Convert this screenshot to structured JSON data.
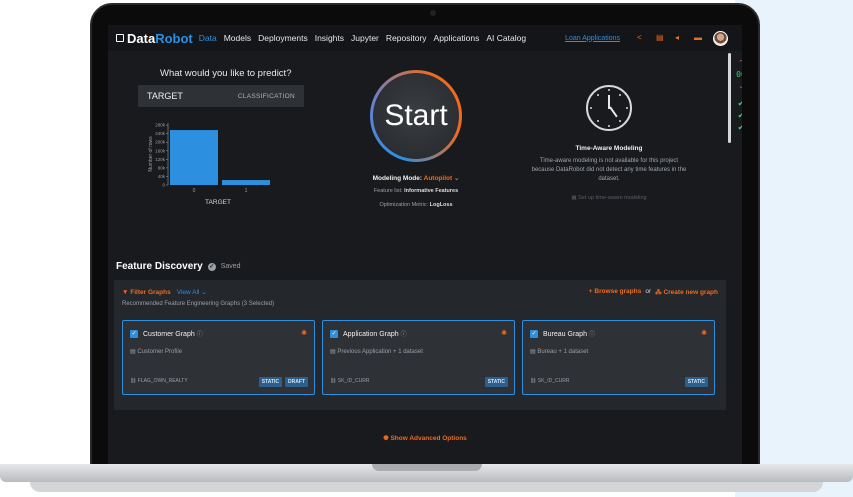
{
  "nav": {
    "logo_a": "Data",
    "logo_b": "Robot",
    "items": [
      "Data",
      "Models",
      "Deployments",
      "Insights",
      "Jupyter",
      "Repository",
      "Applications",
      "AI Catalog"
    ],
    "project_link": "Loan Applications",
    "icons": [
      "share-icon",
      "document-icon",
      "megaphone-icon",
      "folder-icon"
    ]
  },
  "rail": {
    "count": "00"
  },
  "predict": {
    "title": "What would you like to predict?",
    "target": "TARGET",
    "type": "CLASSIFICATION"
  },
  "chart_data": {
    "type": "bar",
    "categories": [
      "0",
      "1"
    ],
    "values": [
      257000,
      23000
    ],
    "xlabel": "TARGET",
    "ylabel": "Number of rows",
    "yticks": [
      "0",
      "40k",
      "80k",
      "120k",
      "160k",
      "200k",
      "240k",
      "280k"
    ],
    "ylim": [
      0,
      290000
    ],
    "bar_color": "#2d8fe0"
  },
  "start": {
    "label": "Start",
    "mode_label": "Modeling Mode:",
    "mode_value": "Autopilot",
    "feature_list_label": "Feature list:",
    "feature_list_value": "Informative Features",
    "metric_label": "Optimization Metric:",
    "metric_value": "LogLoss"
  },
  "time_aware": {
    "title": "Time-Aware Modeling",
    "description": "Time-aware modeling is not available for this project because DataRobot did not detect any time features in the dataset.",
    "link": "Set up time-aware modeling"
  },
  "feature_discovery": {
    "title": "Feature Discovery",
    "saved": "Saved",
    "filter": "Filter Graphs",
    "view_label": "View",
    "view_value": "All",
    "recommended": "Recommended Feature Engineering Graphs (3 Selected)",
    "browse": "Browse graphs",
    "or": "or",
    "create": "Create new graph",
    "cards": [
      {
        "name": "Customer Graph",
        "dataset": "Customer Profile",
        "key": "FLAG_OWN_REALTY",
        "tags": [
          "STATIC",
          "DRAFT"
        ]
      },
      {
        "name": "Application Graph",
        "dataset": "Previous Application  + 1 dataset",
        "key": "SK_ID_CURR",
        "tags": [
          "STATIC"
        ]
      },
      {
        "name": "Bureau Graph",
        "dataset": "Bureau  + 1 dataset",
        "key": "SK_ID_CURR",
        "tags": [
          "STATIC"
        ]
      }
    ]
  },
  "advanced": "Show Advanced Options",
  "colors": {
    "accent": "#2d8fe0",
    "orange": "#f06b1e",
    "success": "#38d07a"
  }
}
